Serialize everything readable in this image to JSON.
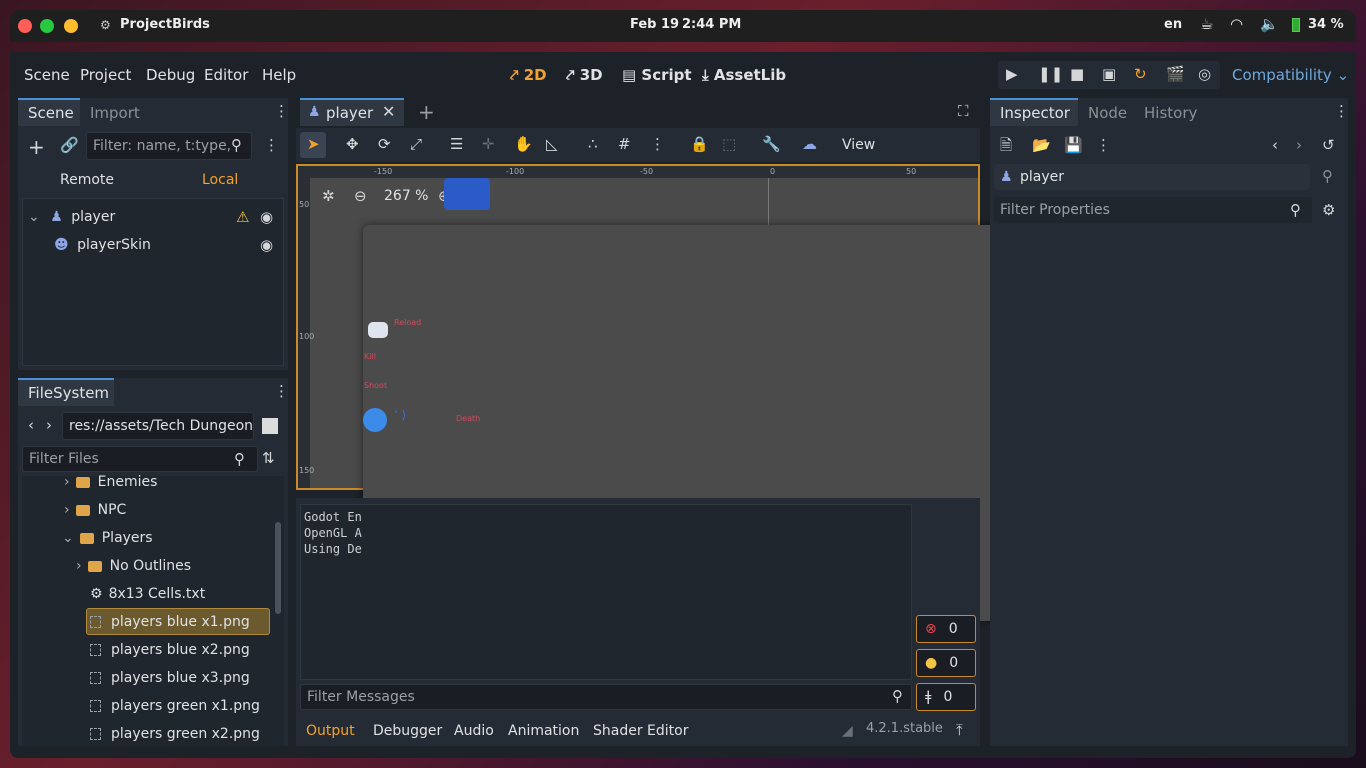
{
  "system_bar": {
    "app_name": "ProjectBirds",
    "date": "Feb 19",
    "time": "2:44 PM",
    "lang": "en",
    "battery": "34 %"
  },
  "menu": [
    "Scene",
    "Project",
    "Debug",
    "Editor",
    "Help"
  ],
  "workspaces": {
    "two_d": "2D",
    "three_d": "3D",
    "script": "Script",
    "assetlib": "AssetLib"
  },
  "renderer": "Compatibility",
  "scene_dock": {
    "tabs": {
      "scene": "Scene",
      "import": "Import"
    },
    "filter_placeholder": "Filter: name, t:type,",
    "remote": "Remote",
    "local": "Local",
    "nodes": {
      "player": "player",
      "player_skin": "playerSkin"
    }
  },
  "filesystem": {
    "tab": "FileSystem",
    "path": "res://assets/Tech Dungeon",
    "filter_placeholder": "Filter Files",
    "items": {
      "enemies": "Enemies",
      "npc": "NPC",
      "players": "Players",
      "no_outlines": "No Outlines",
      "cells": "8x13 Cells.txt",
      "blue_x1": "players blue x1.png",
      "blue_x2": "players blue x2.png",
      "blue_x3": "players blue x3.png",
      "green_x1": "players green x1.png",
      "green_x2": "players green x2.png"
    }
  },
  "editor_tab": {
    "label": "player"
  },
  "viewport": {
    "view_label": "View",
    "zoom": "267 %",
    "ruler_h": [
      "-150",
      "-100",
      "-50",
      "0",
      "50"
    ],
    "ruler_v": [
      "50",
      "100",
      "150"
    ]
  },
  "output": {
    "lines": [
      "Godot En",
      "OpenGL A",
      "Using De"
    ],
    "filter_placeholder": "Filter Messages",
    "counts": {
      "errors": "0",
      "warnings": "0",
      "messages": "0"
    },
    "version": "4.2.1.stable"
  },
  "bottom_tabs": {
    "output": "Output",
    "debugger": "Debugger",
    "audio": "Audio",
    "animation": "Animation",
    "shader": "Shader Editor"
  },
  "inspector": {
    "tabs": {
      "inspector": "Inspector",
      "node": "Node",
      "history": "History"
    },
    "object": "player",
    "filter_placeholder": "Filter Properties"
  },
  "preview_labels": {
    "a": "Reload",
    "b": "Kill",
    "c": "Shoot",
    "d": "Death"
  },
  "colors": {
    "accent": "#f4a22d",
    "selected_bg": "#6b5a2e",
    "panel": "#252b34",
    "window": "#1d2229"
  }
}
